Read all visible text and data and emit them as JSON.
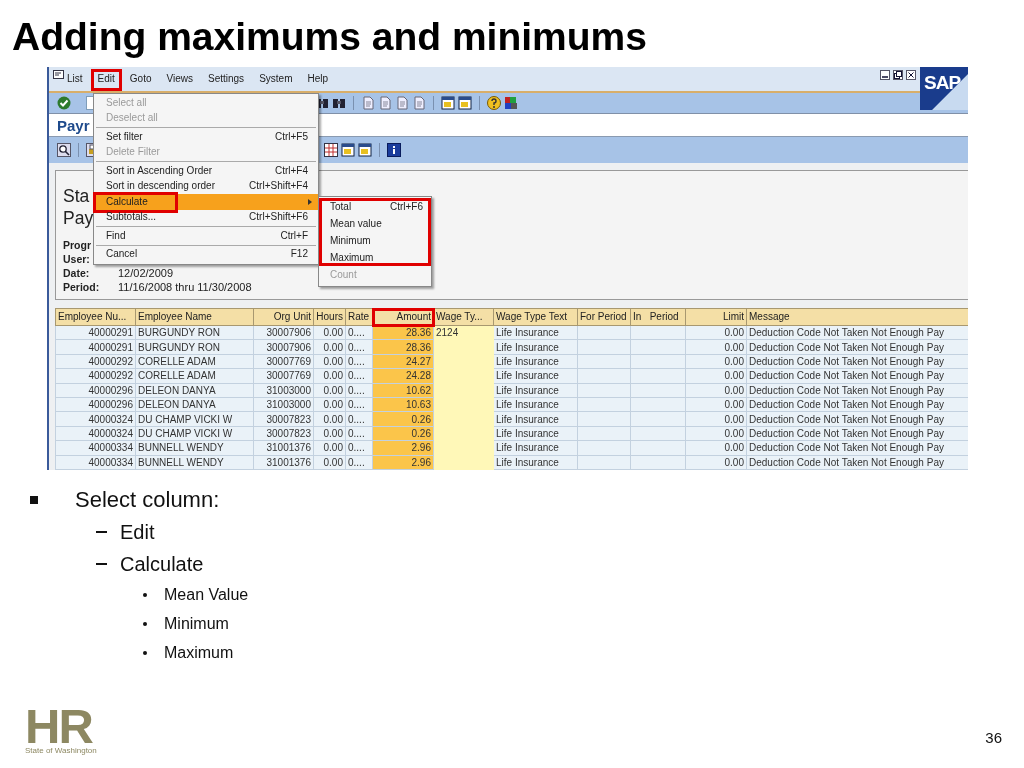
{
  "slide": {
    "title": "Adding maximums and minimums",
    "page_number": "36"
  },
  "sap": {
    "brand": "SAP",
    "menu_bar": [
      {
        "label": "List",
        "highlighted": false
      },
      {
        "label": "Edit",
        "highlighted": true
      },
      {
        "label": "Goto",
        "highlighted": false
      },
      {
        "label": "Views",
        "highlighted": false
      },
      {
        "label": "Settings",
        "highlighted": false
      },
      {
        "label": "System",
        "highlighted": false
      },
      {
        "label": "Help",
        "highlighted": false
      }
    ],
    "title": "Payr",
    "header": {
      "heading_lines": [
        "Sta",
        "Pay"
      ],
      "fields": [
        {
          "label": "Progr"
        },
        {
          "label": "User:"
        },
        {
          "label": "Date:",
          "value": "12/02/2009"
        },
        {
          "label": "Period:",
          "value": "11/16/2008 thru 11/30/2008"
        }
      ]
    },
    "edit_menu": [
      {
        "kind": "item",
        "label": "Select all",
        "disabled": true,
        "selected": false,
        "highlighted": false
      },
      {
        "kind": "item",
        "label": "Deselect all",
        "disabled": true,
        "selected": false,
        "highlighted": false
      },
      {
        "kind": "separator"
      },
      {
        "kind": "item",
        "label": "Set filter",
        "shortcut": "Ctrl+F5",
        "disabled": false,
        "selected": false,
        "highlighted": false
      },
      {
        "kind": "item",
        "label": "Delete Filter",
        "disabled": true,
        "selected": false,
        "highlighted": false
      },
      {
        "kind": "separator"
      },
      {
        "kind": "item",
        "label": "Sort in Ascending Order",
        "shortcut": "Ctrl+F4",
        "disabled": false,
        "selected": false,
        "highlighted": false
      },
      {
        "kind": "item",
        "label": "Sort in descending order",
        "shortcut": "Ctrl+Shift+F4",
        "disabled": false,
        "selected": false,
        "highlighted": false
      },
      {
        "kind": "submenu",
        "label": "Calculate",
        "disabled": false,
        "selected": true,
        "highlighted": true
      },
      {
        "kind": "item",
        "label": "Subtotals...",
        "shortcut": "Ctrl+Shift+F6",
        "disabled": false,
        "selected": false,
        "highlighted": false
      },
      {
        "kind": "separator"
      },
      {
        "kind": "item",
        "label": "Find",
        "shortcut": "Ctrl+F",
        "disabled": false,
        "selected": false,
        "highlighted": false
      },
      {
        "kind": "separator"
      },
      {
        "kind": "item",
        "label": "Cancel",
        "shortcut": "F12",
        "disabled": false,
        "selected": false,
        "highlighted": false
      }
    ],
    "calculate_menu": [
      {
        "label": "Total",
        "shortcut": "Ctrl+F6",
        "disabled": false,
        "highlighted": true
      },
      {
        "label": "Mean value",
        "disabled": false,
        "highlighted": true
      },
      {
        "label": "Minimum",
        "disabled": false,
        "highlighted": true
      },
      {
        "label": "Maximum",
        "disabled": false,
        "highlighted": true
      },
      {
        "label": "Count",
        "disabled": true,
        "highlighted": false
      }
    ],
    "table": {
      "columns": [
        {
          "label": "Employee Nu...",
          "selected": false,
          "emphasized": false,
          "highlighted": false
        },
        {
          "label": "Employee Name",
          "selected": false,
          "emphasized": false,
          "highlighted": false
        },
        {
          "label": "Org Unit",
          "selected": false,
          "emphasized": false,
          "highlighted": false
        },
        {
          "label": "Hours",
          "selected": false,
          "emphasized": false,
          "highlighted": false
        },
        {
          "label": "Rate",
          "selected": false,
          "emphasized": false,
          "highlighted": false
        },
        {
          "label": "Amount",
          "selected": true,
          "emphasized": false,
          "highlighted": true
        },
        {
          "label": "Wage Ty...",
          "selected": false,
          "emphasized": true,
          "highlighted": false
        },
        {
          "label": "Wage Type Text",
          "selected": false,
          "emphasized": false,
          "highlighted": false
        },
        {
          "label": "For Period",
          "selected": false,
          "emphasized": false,
          "highlighted": false
        },
        {
          "label": "In   Period",
          "selected": false,
          "emphasized": false,
          "highlighted": false
        },
        {
          "label": "Limit",
          "selected": false,
          "emphasized": false,
          "highlighted": false
        },
        {
          "label": "Message",
          "selected": false,
          "emphasized": false,
          "highlighted": false
        }
      ],
      "rows": [
        {
          "employee_number": "40000291",
          "employee_name": "BURGUNDY RON",
          "org_unit": "30007906",
          "hours": "0.00",
          "rate": "0....",
          "amount": "28.36",
          "wage_type": "2124",
          "wage_type_text": "Life Insurance",
          "limit": "0.00",
          "message": "Deduction Code Not Taken Not Enough Pay"
        },
        {
          "employee_number": "40000291",
          "employee_name": "BURGUNDY RON",
          "org_unit": "30007906",
          "hours": "0.00",
          "rate": "0....",
          "amount": "28.36",
          "wage_type_text": "Life Insurance",
          "limit": "0.00",
          "message": "Deduction Code Not Taken Not Enough Pay"
        },
        {
          "employee_number": "40000292",
          "employee_name": "CORELLE ADAM",
          "org_unit": "30007769",
          "hours": "0.00",
          "rate": "0....",
          "amount": "24.27",
          "wage_type_text": "Life Insurance",
          "limit": "0.00",
          "message": "Deduction Code Not Taken Not Enough Pay"
        },
        {
          "employee_number": "40000292",
          "employee_name": "CORELLE ADAM",
          "org_unit": "30007769",
          "hours": "0.00",
          "rate": "0....",
          "amount": "24.28",
          "wage_type_text": "Life Insurance",
          "limit": "0.00",
          "message": "Deduction Code Not Taken Not Enough Pay"
        },
        {
          "employee_number": "40000296",
          "employee_name": "DELEON DANYA",
          "org_unit": "31003000",
          "hours": "0.00",
          "rate": "0....",
          "amount": "10.62",
          "wage_type_text": "Life Insurance",
          "limit": "0.00",
          "message": "Deduction Code Not Taken Not Enough Pay"
        },
        {
          "employee_number": "40000296",
          "employee_name": "DELEON DANYA",
          "org_unit": "31003000",
          "hours": "0.00",
          "rate": "0....",
          "amount": "10.63",
          "wage_type_text": "Life Insurance",
          "limit": "0.00",
          "message": "Deduction Code Not Taken Not Enough Pay"
        },
        {
          "employee_number": "40000324",
          "employee_name": "DU CHAMP VICKI W",
          "org_unit": "30007823",
          "hours": "0.00",
          "rate": "0....",
          "amount": "0.26",
          "wage_type_text": "Life Insurance",
          "limit": "0.00",
          "message": "Deduction Code Not Taken Not Enough Pay"
        },
        {
          "employee_number": "40000324",
          "employee_name": "DU CHAMP VICKI W",
          "org_unit": "30007823",
          "hours": "0.00",
          "rate": "0....",
          "amount": "0.26",
          "wage_type_text": "Life Insurance",
          "limit": "0.00",
          "message": "Deduction Code Not Taken Not Enough Pay"
        },
        {
          "employee_number": "40000334",
          "employee_name": "BUNNELL WENDY",
          "org_unit": "31001376",
          "hours": "0.00",
          "rate": "0....",
          "amount": "2.96",
          "wage_type_text": "Life Insurance",
          "limit": "0.00",
          "message": "Deduction Code Not Taken Not Enough Pay"
        },
        {
          "employee_number": "40000334",
          "employee_name": "BUNNELL WENDY",
          "org_unit": "31001376",
          "hours": "0.00",
          "rate": "0....",
          "amount": "2.96",
          "wage_type_text": "Life Insurance",
          "limit": "0.00",
          "message": "Deduction Code Not Taken Not Enough Pay"
        }
      ]
    }
  },
  "bullets": [
    {
      "text": "Select column:",
      "children": [
        {
          "text": "Edit"
        },
        {
          "text": "Calculate",
          "children": [
            {
              "text": "Mean Value"
            },
            {
              "text": "Minimum"
            },
            {
              "text": "Maximum"
            }
          ]
        }
      ]
    }
  ],
  "logo": {
    "mark": "HR",
    "caption": "State of Washington"
  }
}
